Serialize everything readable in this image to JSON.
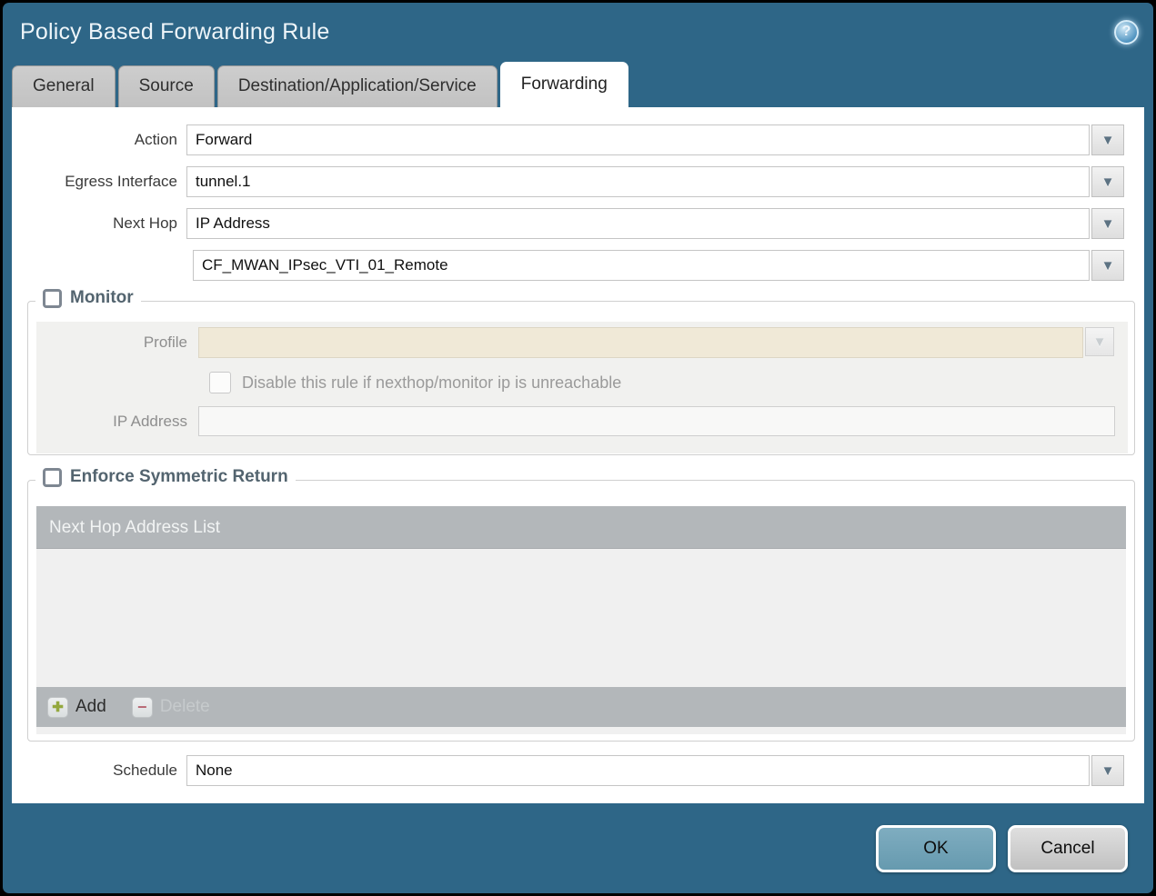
{
  "window": {
    "title": "Policy Based Forwarding Rule"
  },
  "tabs": [
    {
      "label": "General",
      "active": false
    },
    {
      "label": "Source",
      "active": false
    },
    {
      "label": "Destination/Application/Service",
      "active": false
    },
    {
      "label": "Forwarding",
      "active": true
    }
  ],
  "form": {
    "action": {
      "label": "Action",
      "value": "Forward"
    },
    "egress_interface": {
      "label": "Egress Interface",
      "value": "tunnel.1"
    },
    "next_hop": {
      "label": "Next Hop",
      "value": "IP Address"
    },
    "next_hop_value": {
      "value": "CF_MWAN_IPsec_VTI_01_Remote"
    },
    "schedule": {
      "label": "Schedule",
      "value": "None"
    }
  },
  "monitor": {
    "legend": "Monitor",
    "checked": false,
    "profile": {
      "label": "Profile",
      "value": ""
    },
    "disable_rule": {
      "label": "Disable this rule if nexthop/monitor ip is unreachable",
      "checked": false
    },
    "ip_address": {
      "label": "IP Address",
      "value": ""
    }
  },
  "symmetric_return": {
    "legend": "Enforce Symmetric Return",
    "checked": false,
    "table": {
      "header": "Next Hop Address List",
      "rows": []
    },
    "add_label": "Add",
    "delete_label": "Delete"
  },
  "footer": {
    "ok_label": "OK",
    "cancel_label": "Cancel"
  },
  "icons": {
    "help": "?",
    "dropdown": "▼",
    "add": "✚",
    "delete": "−"
  },
  "colors": {
    "titlebar_teal": "#2e6687",
    "active_tab": "#ffffff",
    "inactive_tab": "#c6c6c6",
    "disabled_field_beige": "#f0e9d7",
    "table_header_gray": "#b3b7ba",
    "ok_button": "#70a2b7",
    "add_green": "#94a83e",
    "delete_red": "#b96a76"
  }
}
